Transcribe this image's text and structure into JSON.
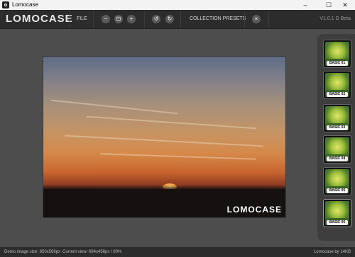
{
  "window": {
    "title": "Lomocase",
    "minimize_glyph": "–",
    "maximize_glyph": "☐",
    "close_glyph": "✕"
  },
  "toolbar": {
    "logo": "LOMOCASE",
    "file_label": "FILE",
    "zoom_out_glyph": "−",
    "fit_glyph": "⊡",
    "zoom_in_glyph": "+",
    "rotate_left_glyph": "↺",
    "rotate_right_glyph": "↻",
    "collection_presets_label": "COLLECTION PRESETS",
    "close_glyph": "×",
    "version": "V1.0.1 D Beta"
  },
  "canvas": {
    "watermark": "LOMOCASE"
  },
  "presets": [
    {
      "label": "BASIC 01"
    },
    {
      "label": "BASIC 02"
    },
    {
      "label": "BASIC 03"
    },
    {
      "label": "BASIC 04"
    },
    {
      "label": "BASIC 05"
    },
    {
      "label": "BASIC 06"
    }
  ],
  "status": {
    "demo_size": "Demo image size: 850x566px",
    "current_view": "Current view: 684x456px / 80%",
    "app_size": "Lomocase by 14KB"
  },
  "colors": {
    "toolbar_bg": "#2c2c2c",
    "canvas_bg": "#4d4d4d",
    "panel_bg": "#3e3e3e"
  }
}
